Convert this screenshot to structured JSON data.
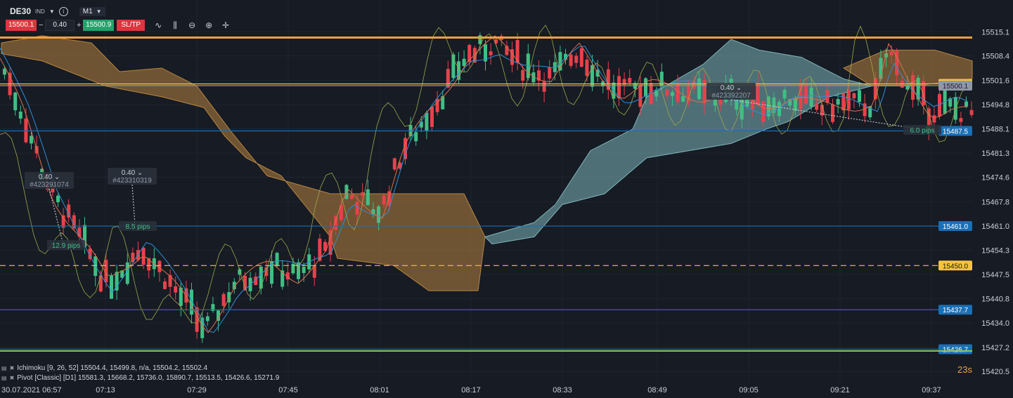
{
  "toolbar": {
    "symbol": "DE30",
    "symbol_tag": "IND",
    "timeframe": "M1",
    "sell_price": "15500.1",
    "quantity": "0.40",
    "buy_price": "15500.9",
    "sltp_label": "SL/TP",
    "minus": "−",
    "plus": "+"
  },
  "indicators": {
    "ichimoku": "Ichimoku [9, 26, 52] 15504.4, 15499.8, n/a, 15504.2, 15502.4",
    "pivot": "Pivot [Classic] [D1] 15581.3, 15668.2, 15736.0, 15890.7, 15513.5, 15426.6, 15271.9"
  },
  "countdown": "23s",
  "colors": {
    "background": "#161b24",
    "bull": "#3fbf84",
    "bear": "#e8414b",
    "orange_line": "#f5a13a",
    "cloud_bear": "#b8843f",
    "cloud_bull": "#7fb5b9",
    "pivot_blue": "#1a6fb5"
  },
  "chart_data": {
    "type": "candlestick",
    "price_axis": {
      "range": [
        15418.0,
        15522.0
      ],
      "ticks": [
        "15515.1",
        "15508.4",
        "15501.6",
        "15494.8",
        "15488.1",
        "15481.3",
        "15474.6",
        "15467.8",
        "15461.0",
        "15454.3",
        "15447.5",
        "15440.8",
        "15434.0",
        "15427.2",
        "15420.5"
      ]
    },
    "time_axis": {
      "first_label": "30.07.2021 06:57",
      "labels": [
        "07:13",
        "07:29",
        "07:45",
        "08:01",
        "08:17",
        "08:33",
        "08:49",
        "09:05",
        "09:21",
        "09:37"
      ]
    },
    "horizontal_lines": [
      {
        "price": 15513.5,
        "label": "",
        "color": "#f5a13a",
        "style": "solid"
      },
      {
        "price": 15500.6,
        "label": "15500.6",
        "color": "#f5c242",
        "style": "solid"
      },
      {
        "price": 15500.1,
        "label": "15500.1",
        "color": "#8f98a6",
        "style": "solid"
      },
      {
        "price": 15487.5,
        "label": "15487.5",
        "color": "#1a6fb5",
        "style": "solid"
      },
      {
        "price": 15461.0,
        "label": "15461.0",
        "color": "#1a6fb5",
        "style": "solid"
      },
      {
        "price": 15450.0,
        "label": "15450.0",
        "color": "#f5c242",
        "style": "dashed"
      },
      {
        "price": 15437.7,
        "label": "15437.7",
        "color": "#1a6fb5",
        "style": "solid"
      },
      {
        "price": 15426.7,
        "label": "15426.7",
        "color": "#1a6fb5",
        "style": "solid"
      }
    ],
    "trade_markers": [
      {
        "size": "0.40",
        "id": "#423291074",
        "pips": "12.9 pips"
      },
      {
        "size": "0.40",
        "id": "#423310319",
        "pips": "8.5 pips"
      },
      {
        "size": "0.40",
        "id": "#423392207",
        "pips": "6.0 pips"
      }
    ]
  }
}
